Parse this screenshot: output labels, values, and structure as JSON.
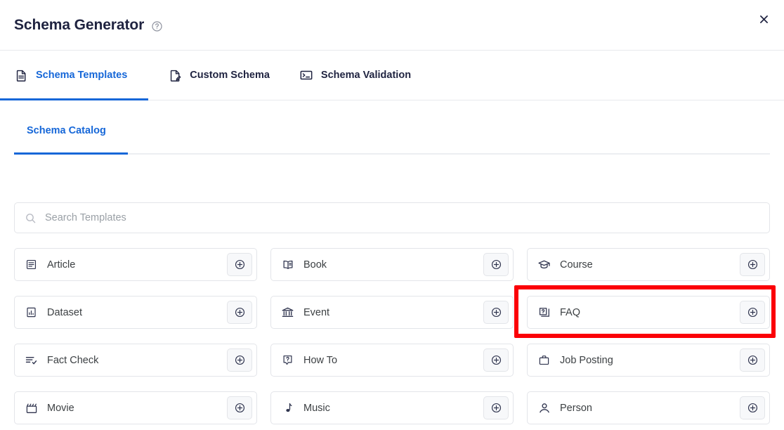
{
  "header": {
    "title": "Schema Generator",
    "help_icon": "help-circle-icon",
    "close_icon": "close-icon"
  },
  "tabs": [
    {
      "label": "Schema Templates",
      "icon": "document-icon",
      "active": true
    },
    {
      "label": "Custom Schema",
      "icon": "document-edit-icon",
      "active": false
    },
    {
      "label": "Schema Validation",
      "icon": "terminal-icon",
      "active": false
    }
  ],
  "subtabs": [
    {
      "label": "Schema Catalog",
      "active": true
    }
  ],
  "search": {
    "placeholder": "Search Templates",
    "value": "",
    "icon": "search-icon"
  },
  "templates": [
    {
      "label": "Article",
      "icon": "article-icon",
      "add_icon": "plus-circle-icon",
      "highlighted": false
    },
    {
      "label": "Book",
      "icon": "book-icon",
      "add_icon": "plus-circle-icon",
      "highlighted": false
    },
    {
      "label": "Course",
      "icon": "graduation-cap-icon",
      "add_icon": "plus-circle-icon",
      "highlighted": false
    },
    {
      "label": "Dataset",
      "icon": "chart-box-icon",
      "add_icon": "plus-circle-icon",
      "highlighted": false
    },
    {
      "label": "Event",
      "icon": "landmark-icon",
      "add_icon": "plus-circle-icon",
      "highlighted": false
    },
    {
      "label": "FAQ",
      "icon": "faq-icon",
      "add_icon": "plus-circle-icon",
      "highlighted": true
    },
    {
      "label": "Fact Check",
      "icon": "list-check-icon",
      "add_icon": "plus-circle-icon",
      "highlighted": false
    },
    {
      "label": "How To",
      "icon": "question-box-icon",
      "add_icon": "plus-circle-icon",
      "highlighted": false
    },
    {
      "label": "Job Posting",
      "icon": "briefcase-icon",
      "add_icon": "plus-circle-icon",
      "highlighted": false
    },
    {
      "label": "Movie",
      "icon": "clapperboard-icon",
      "add_icon": "plus-circle-icon",
      "highlighted": false
    },
    {
      "label": "Music",
      "icon": "music-note-icon",
      "add_icon": "plus-circle-icon",
      "highlighted": false
    },
    {
      "label": "Person",
      "icon": "person-icon",
      "add_icon": "plus-circle-icon",
      "highlighted": false
    }
  ],
  "colors": {
    "accent": "#1667d8",
    "highlight": "#fb0007",
    "text": "#3c4043",
    "title": "#1f2340",
    "border": "#e3e5e9"
  }
}
